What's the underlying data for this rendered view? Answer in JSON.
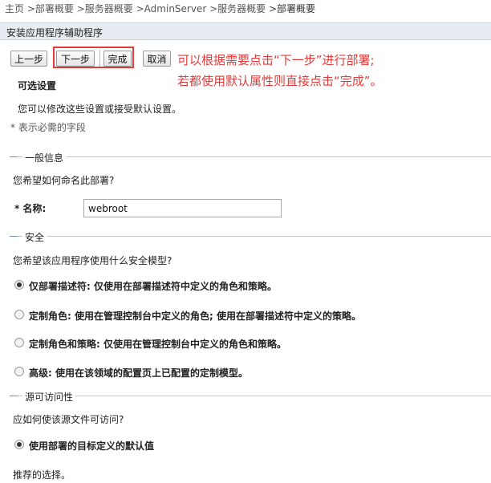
{
  "breadcrumb": {
    "items": [
      "主页",
      ">部署概要",
      ">服务器概要",
      ">AdminServer",
      ">服务器概要",
      ">部署概要"
    ]
  },
  "wizard": {
    "title": "安装应用程序辅助程序",
    "buttons": {
      "prev": "上一步",
      "next": "下一步",
      "finish": "完成",
      "cancel": "取消"
    }
  },
  "annotation": {
    "line1": "可以根据需要点击“下一步”进行部署;",
    "line2": "若都使用默认属性则直接点击“完成”。",
    "color": "#e23b3b"
  },
  "optional": {
    "heading": "可选设置",
    "desc": "您可以修改这些设置或接受默认设置。",
    "required_note": "* 表示必需的字段"
  },
  "general": {
    "section_label": "一般信息",
    "question": "您希望如何命名此部署?",
    "name_label": "* 名称:",
    "name_value": "webroot"
  },
  "security": {
    "section_label": "安全",
    "question": "您希望该应用程序使用什么安全模型?",
    "options": [
      {
        "label": "仅部署描述符: 仅使用在部署描述符中定义的角色和策略。",
        "checked": true
      },
      {
        "label": "定制角色: 使用在管理控制台中定义的角色; 使用在部署描述符中定义的策略。",
        "checked": false
      },
      {
        "label": "定制角色和策略: 仅使用在管理控制台中定义的角色和策略。",
        "checked": false
      },
      {
        "label": "高级: 使用在该领域的配置页上已配置的定制模型。",
        "checked": false
      }
    ]
  },
  "source": {
    "section_label": "源可访问性",
    "question": "应如何使该源文件可访问?",
    "option": {
      "label": "使用部署的目标定义的默认值",
      "checked": true
    },
    "note": "推荐的选择。"
  }
}
